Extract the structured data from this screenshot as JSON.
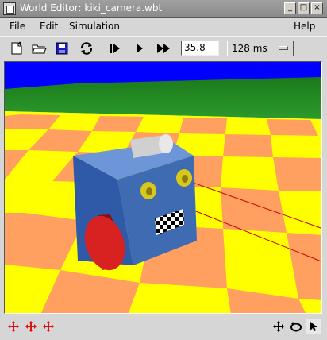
{
  "window": {
    "title": "World Editor: kiki_camera.wbt",
    "controls": [
      "_",
      "□",
      "×"
    ]
  },
  "menu": {
    "file": "File",
    "edit": "Edit",
    "simulation": "Simulation",
    "help": "Help"
  },
  "toolbar": {
    "icons": [
      "new-world-icon",
      "open-world-icon",
      "save-world-icon",
      "revert-icon",
      "step-icon",
      "run-icon",
      "fast-run-icon"
    ],
    "step_value": "35.8",
    "time_step": "128 ms"
  },
  "scene": {
    "sky_color": "#0000ff",
    "floor_colors": [
      "#ffff00",
      "#ffa060"
    ],
    "robot_body_color": "#3f6bb3",
    "wheel_color": "#d82222",
    "sensor_color": "#d8c81c",
    "ray_color": "#cc0000"
  },
  "bottom": {
    "left_icons": [
      "move-x-icon",
      "move-y-icon",
      "move-z-icon"
    ],
    "right_icons": [
      "translate-view-icon",
      "rotate-view-icon",
      "pointer-icon"
    ]
  }
}
